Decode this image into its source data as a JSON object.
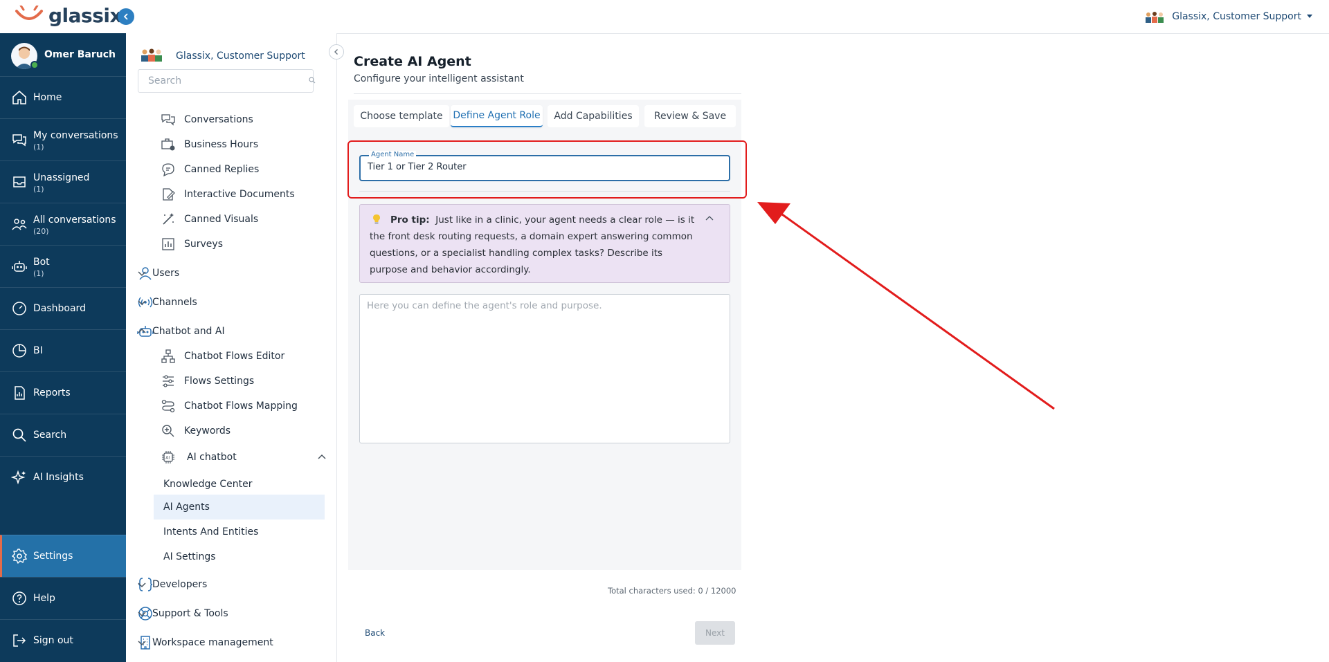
{
  "app": {
    "logo_text": "glassix",
    "user_name": "Omer Baruch",
    "workspace": "Glassix, Customer Support"
  },
  "nav": {
    "home": "Home",
    "my_conversations": "My conversations",
    "my_conversations_count": "(1)",
    "unassigned": "Unassigned",
    "unassigned_count": "(1)",
    "all_conversations": "All conversations",
    "all_conversations_count": "(20)",
    "bot": "Bot",
    "bot_count": "(1)",
    "dashboard": "Dashboard",
    "bi": "BI",
    "reports": "Reports",
    "search": "Search",
    "ai_insights": "AI Insights",
    "settings": "Settings",
    "help": "Help",
    "sign_out": "Sign out"
  },
  "settings_menu": {
    "search_placeholder": "Search",
    "conversations": "Conversations",
    "business_hours": "Business Hours",
    "canned_replies": "Canned Replies",
    "interactive_documents": "Interactive Documents",
    "canned_visuals": "Canned Visuals",
    "surveys": "Surveys",
    "users": "Users",
    "channels": "Channels",
    "chatbot_and_ai": "Chatbot and AI",
    "chatbot_flows_editor": "Chatbot Flows Editor",
    "flows_settings": "Flows Settings",
    "chatbot_flows_mapping": "Chatbot Flows Mapping",
    "keywords": "Keywords",
    "ai_chatbot": "AI chatbot",
    "knowledge_center": "Knowledge Center",
    "ai_agents": "AI Agents",
    "intents_and_entities": "Intents And Entities",
    "ai_settings": "AI Settings",
    "developers": "Developers",
    "support_tools": "Support & Tools",
    "workspace_management": "Workspace management"
  },
  "main": {
    "title": "Create AI Agent",
    "subtitle": "Configure your intelligent assistant",
    "steps": [
      "Choose template",
      "Define Agent Role",
      "Add Capabilities",
      "Review & Save"
    ],
    "agent_name_label": "Agent Name",
    "agent_name_value": "Tier 1 or Tier 2 Router",
    "pro_tip_label": "Pro tip:",
    "pro_tip_text": "Just like in a clinic, your agent needs a clear role — is it the front desk routing requests, a domain expert answering common questions, or a specialist handling complex tasks? Describe its purpose and behavior accordingly.",
    "role_placeholder": "Here you can define the agent's role and purpose.",
    "char_count": "Total characters used: 0 / 12000",
    "back_label": "Back",
    "next_label": "Next"
  },
  "colors": {
    "nav_bg": "#0d3a5b",
    "nav_active": "#2471a8",
    "accent": "#2a7ec7",
    "annotation_red": "#e21c1c",
    "pro_tip_bg": "#ece2f3"
  }
}
